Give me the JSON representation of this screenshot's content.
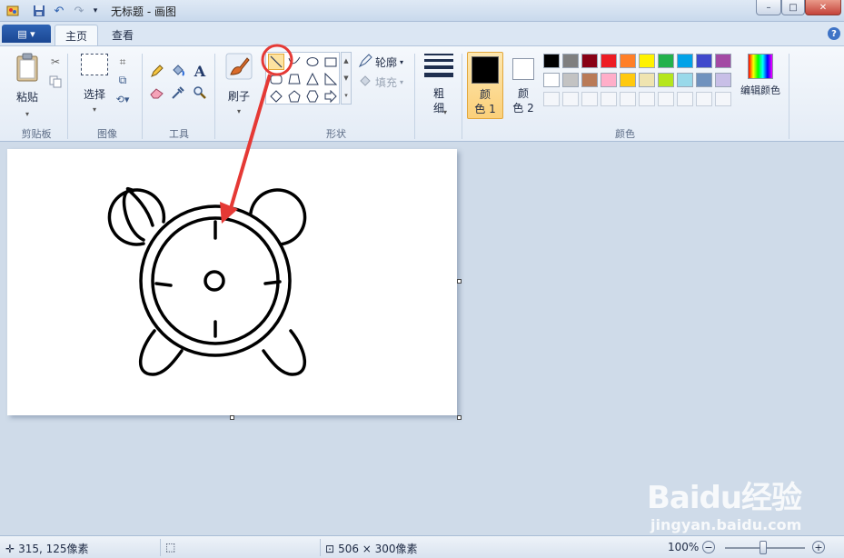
{
  "window": {
    "title": "无标题 - 画图",
    "controls": {
      "minimize": "–",
      "maximize": "□",
      "close": "✕"
    }
  },
  "quick_access": {
    "icons": [
      "paint-app-icon",
      "save-icon",
      "undo-icon",
      "redo-icon",
      "customize-dropdown-icon"
    ]
  },
  "tabs": {
    "file_icon": "▤ ▾",
    "home": "主页",
    "view": "查看",
    "help": "?"
  },
  "ribbon": {
    "clipboard": {
      "paste_label": "粘贴",
      "group_label": "剪贴板"
    },
    "image": {
      "select_label": "选择",
      "group_label": "图像"
    },
    "tools": {
      "group_label": "工具"
    },
    "brush": {
      "label": "刷子"
    },
    "shapes": {
      "outline_label": "轮廓",
      "fill_label": "填充",
      "group_label": "形状",
      "selected_shape": "line"
    },
    "size": {
      "label": "粗\n细"
    },
    "colors": {
      "color1_label": "颜\n色 1",
      "color2_label": "颜\n色 2",
      "edit_colors_label": "编辑颜色",
      "group_label": "颜色",
      "color1_value": "#000000",
      "color2_value": "#ffffff",
      "palette_row1": [
        "#000000",
        "#7f7f7f",
        "#880015",
        "#ed1c24",
        "#ff7f27",
        "#fff200",
        "#22b14c",
        "#00a2e8",
        "#3f48cc",
        "#a349a4"
      ],
      "palette_row2": [
        "#ffffff",
        "#c3c3c3",
        "#b97a57",
        "#ffaec9",
        "#ffc90e",
        "#efe4b0",
        "#b5e61d",
        "#99d9ea",
        "#7092be",
        "#c8bfe7"
      ]
    }
  },
  "status": {
    "cursor_position": "315, 125像素",
    "canvas_size": "506 × 300像素",
    "zoom": "100%",
    "zoom_out": "−",
    "zoom_in": "+"
  },
  "watermark": {
    "brand": "Baidu经验",
    "url": "jingyan.baidu.com"
  },
  "annotation": {
    "highlight_color": "#e53935"
  }
}
